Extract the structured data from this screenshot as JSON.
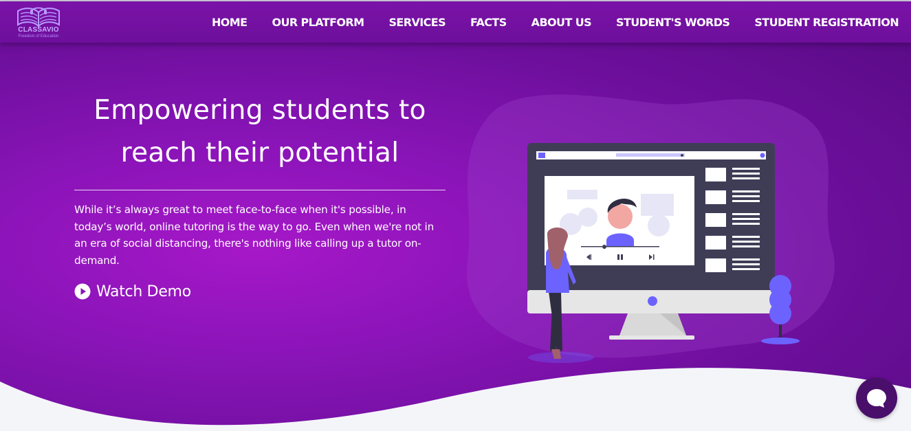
{
  "brand": {
    "name": "CLASSAVIO",
    "tagline": "Freedom of Education"
  },
  "nav": {
    "items": [
      {
        "label": "HOME"
      },
      {
        "label": "OUR PLATFORM"
      },
      {
        "label": "SERVICES"
      },
      {
        "label": "FACTS"
      },
      {
        "label": "ABOUT US"
      },
      {
        "label": "STUDENT'S WORDS"
      },
      {
        "label": "STUDENT REGISTRATION"
      }
    ]
  },
  "hero": {
    "headline_line1": "Empowering students to",
    "headline_line2": "reach their potential",
    "body": "While it’s always great to meet face-to-face when it's possible, in today’s world, online tutoring is the way to go. Even when we're not in an era of social distancing, there's nothing like calling up a tutor on-demand.",
    "watch_demo_label": "Watch Demo"
  },
  "icons": {
    "watch_demo": "play-circle-icon",
    "chat": "chat-bubble-icon"
  },
  "colors": {
    "hero_background": "#8a14b8",
    "nav_background": "#7a12a8",
    "accent_illustration": "#6c63ff",
    "chat_button": "#4a0f6b",
    "page_background": "#f4f5f9"
  }
}
